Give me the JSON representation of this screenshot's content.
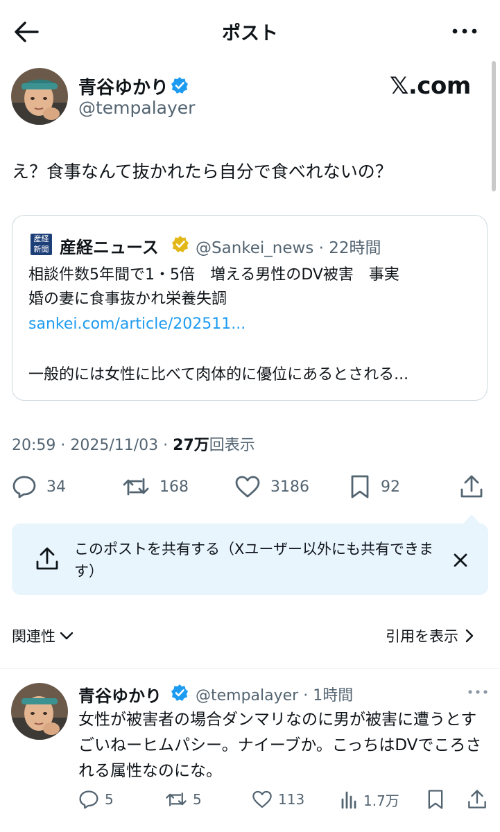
{
  "header": {
    "title": "ポスト"
  },
  "post": {
    "author_name": "青谷ゆかり",
    "author_handle": "@tempalayer",
    "source_badge": "𝕏.com",
    "text": "え？食事なんて抜かれたら自分で食べれないの？",
    "timestamp": "20:59 · 2025/11/03 · ",
    "views_count": "27万",
    "views_label": "回表示",
    "replies": "34",
    "reposts": "168",
    "likes": "3186",
    "bookmarks": "92"
  },
  "quote": {
    "logo_text": "産経新聞",
    "author_name": "産経ニュース",
    "author_handle": "@Sankei_news",
    "time": " · 22時間",
    "line1": "相談件数5年間で1・5倍　増える男性のDV被害　事実",
    "line2": "婚の妻に食事抜かれ栄養失調",
    "link": "sankei.com/article/202511...",
    "line3": "一般的には女性に比べて肉体的に優位にあるとされる..."
  },
  "share_banner": {
    "text": "このポストを共有する（Xユーザー以外にも共有できます）"
  },
  "related": {
    "label": "関連性",
    "view_quotes": "引用を表示"
  },
  "reply": {
    "author_name": "青谷ゆかり",
    "author_handle": "@tempalayer",
    "time": " · 1時間",
    "text": "女性が被害者の場合ダンマリなのに男が被害に遭うとすごいねーヒムパシー。ナイーブか。こっちはDVでころされる属性なのにな。",
    "replies": "5",
    "reposts": "5",
    "likes": "113",
    "views": "1.7万"
  },
  "colors": {
    "accent": "#1d9bf0",
    "verified_blue": "#1d9bf0",
    "verified_gold": "#e2b719",
    "share_bg": "#e8f5fd",
    "muted": "#536471"
  },
  "icons": [
    "back-arrow-icon",
    "more-icon",
    "verified-icon",
    "reply-icon",
    "repost-icon",
    "like-icon",
    "bookmark-icon",
    "share-icon",
    "upload-icon",
    "close-icon",
    "chevron-down-icon",
    "chevron-right-icon",
    "views-icon"
  ]
}
